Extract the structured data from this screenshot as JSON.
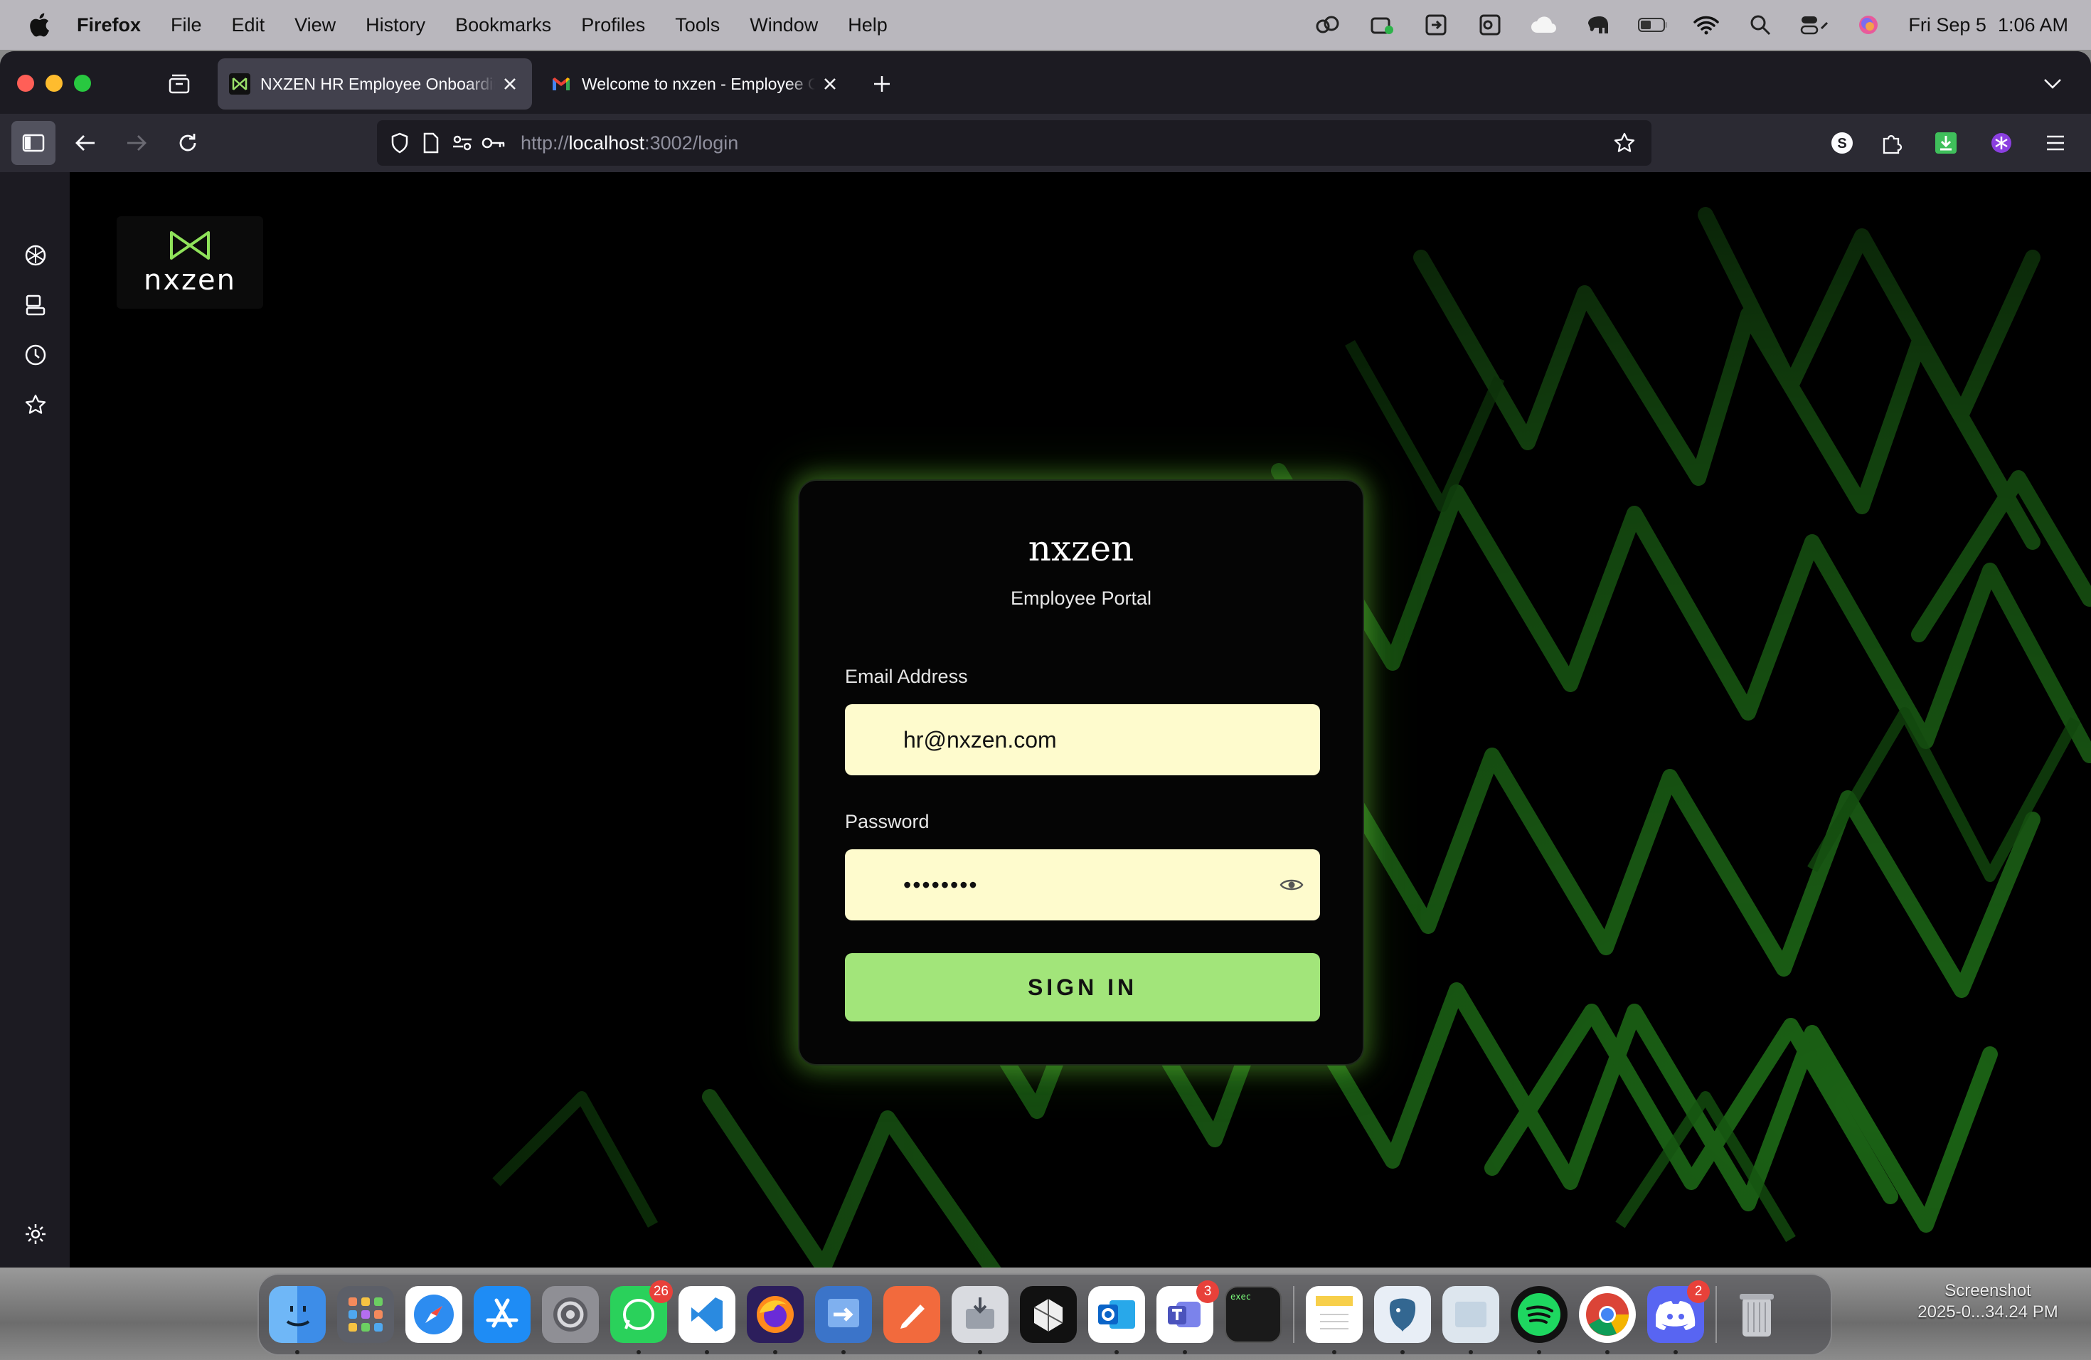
{
  "menubar": {
    "app_name": "Firefox",
    "items": [
      "File",
      "Edit",
      "View",
      "History",
      "Bookmarks",
      "Profiles",
      "Tools",
      "Window",
      "Help"
    ],
    "clock_date": "Fri Sep 5",
    "clock_time": "1:06 AM"
  },
  "browser": {
    "tabs": [
      {
        "title": "NXZEN HR Employee Onboarding",
        "active": true
      },
      {
        "title": "Welcome to nxzen - Employee Onboarding",
        "active": false
      }
    ],
    "url": {
      "scheme": "http://",
      "host": "localhost",
      "rest": ":3002/login"
    }
  },
  "page": {
    "logo_text": "nxzen",
    "card": {
      "brand": "nxzen",
      "subtitle": "Employee Portal",
      "email_label": "Email Address",
      "email_value": "hr@nxzen.com",
      "password_label": "Password",
      "password_masked": "••••••••",
      "signin_label": "SIGN IN"
    },
    "colors": {
      "accent_green": "#a2e57a",
      "input_bg": "#fefbcd",
      "page_bg": "#000000"
    }
  },
  "dock": {
    "badges": {
      "whatsapp": "26",
      "teams": "3",
      "discord": "2"
    },
    "terminal_text": "exec"
  },
  "screenshot_label": {
    "line1": "Screenshot",
    "line2": "2025-0...34.24 PM"
  }
}
